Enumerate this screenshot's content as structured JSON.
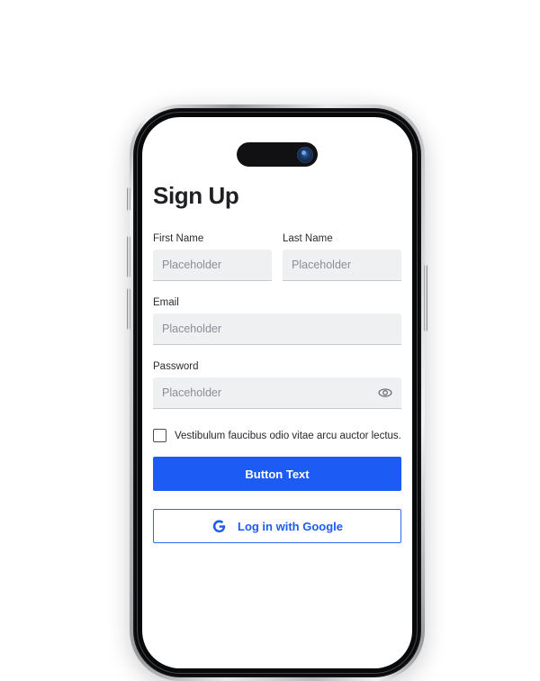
{
  "device": {
    "type": "smartphone-mockup",
    "island_label": "dynamic-island",
    "camera_label": "front-camera"
  },
  "screen": {
    "title": "Sign Up",
    "fields": [
      {
        "label": "First Name",
        "value": "Placeholder",
        "placeholder": "Placeholder",
        "has_eye_toggle": false
      },
      {
        "label": "Last Name",
        "value": "Placeholder",
        "placeholder": "Placeholder",
        "has_eye_toggle": false
      },
      {
        "label": "Email",
        "value": "Placeholder",
        "placeholder": "Placeholder",
        "has_eye_toggle": false
      },
      {
        "label": "Password",
        "value": "Placeholder",
        "placeholder": "Placeholder",
        "has_eye_toggle": true
      }
    ],
    "consent": {
      "checked": false,
      "label": "Vestibulum faucibus odio vitae arcu auctor lectus."
    },
    "primary_button": {
      "label": "Button Text"
    },
    "google_button": {
      "label": "Log in with Google",
      "icon": "google-g-icon"
    }
  },
  "colors": {
    "accent": "#1c5bf4",
    "google_border": "#2f6bf5",
    "input_background": "#eef0f2",
    "input_underline": "#c6c9cd",
    "placeholder_text": "#8b8f95",
    "title_text": "#1f2023",
    "page_background": "#ffffff"
  }
}
